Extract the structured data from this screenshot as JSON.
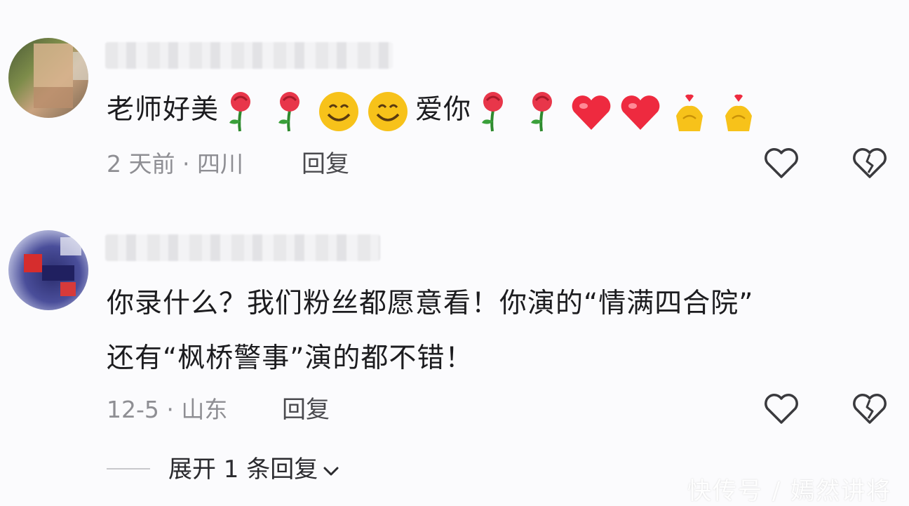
{
  "comments": [
    {
      "text": "老师好美",
      "text_2": "爱你",
      "emojis_a": [
        "rose-icon",
        "rose-icon",
        "smile-icon",
        "smile-icon"
      ],
      "emojis_b": [
        "rose-icon",
        "rose-icon",
        "heart-icon",
        "heart-icon",
        "finger-heart-icon",
        "finger-heart-icon"
      ],
      "time_location": "2 天前 · 四川",
      "reply_label": "回复"
    },
    {
      "text_line1": "你录什么？我们粉丝都愿意看！你演的“情满四合院”",
      "text_line2": "还有“枫桥警事”演的都不错！",
      "time_location": "12-5 · 山东",
      "reply_label": "回复"
    }
  ],
  "expand_label": "展开 1 条回复",
  "watermark": "快传号 / 嫣然讲将",
  "colors": {
    "heart": "#ee2a3f",
    "rose": "#e8364a",
    "emoji_yellow": "#f7c21a",
    "meta_gray": "#8e8e93"
  }
}
